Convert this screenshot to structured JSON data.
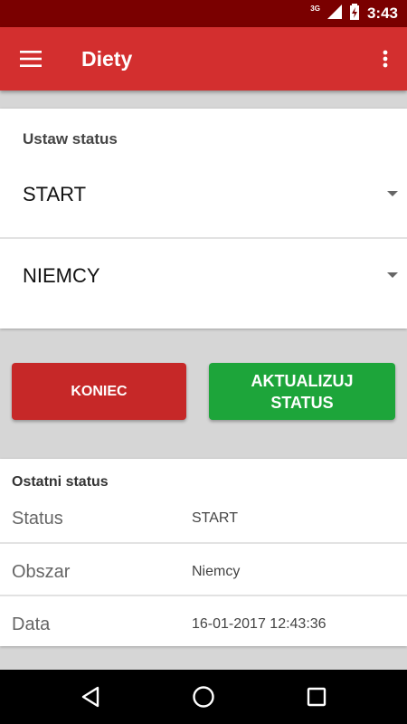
{
  "status_bar": {
    "network": "3G",
    "time": "3:43"
  },
  "toolbar": {
    "title": "Diety",
    "menu_icon": "hamburger-menu-icon",
    "more_icon": "more-vertical-icon",
    "color": "#d32f2f"
  },
  "set_status": {
    "label": "Ustaw status",
    "status_select": {
      "value": "START"
    },
    "area_select": {
      "value": "NIEMCY"
    }
  },
  "actions": {
    "end_label": "KONIEC",
    "end_color": "#c62828",
    "update_label_line1": "AKTUALIZUJ",
    "update_label_line2": "STATUS",
    "update_color": "#1da53a"
  },
  "last_status": {
    "label": "Ostatni status",
    "rows": [
      {
        "key": "Status",
        "value": "START"
      },
      {
        "key": "Obszar",
        "value": "Niemcy"
      },
      {
        "key": "Data",
        "value": "16-01-2017 12:43:36"
      }
    ]
  },
  "nav_bar": {
    "back_icon": "back-triangle-icon",
    "home_icon": "home-circle-icon",
    "recent_icon": "recent-apps-square-icon"
  }
}
